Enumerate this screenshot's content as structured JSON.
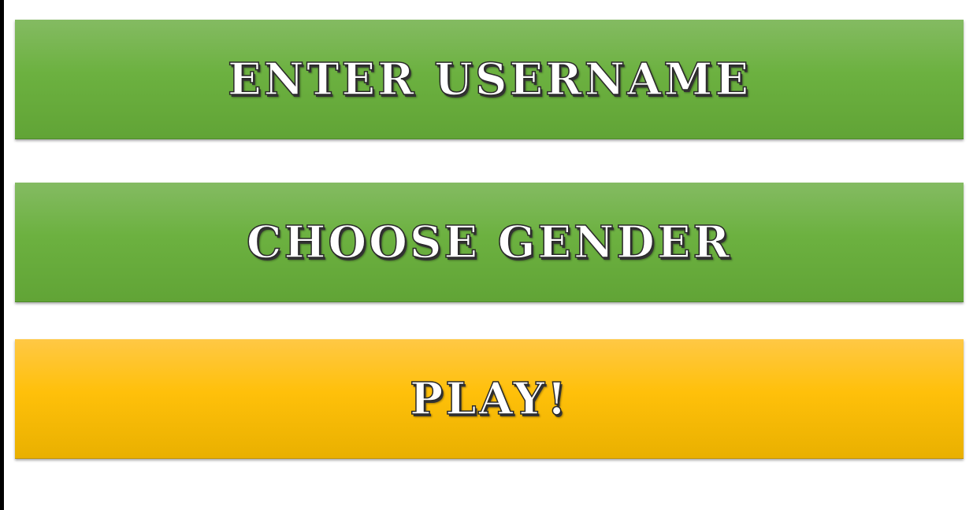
{
  "menu": {
    "username_label": "Enter Username",
    "gender_label": "Choose Gender",
    "play_label": "Play!"
  },
  "colors": {
    "green_button": "#6cb140",
    "yellow_button": "#ffc00a",
    "label_text": "#ffffff"
  }
}
